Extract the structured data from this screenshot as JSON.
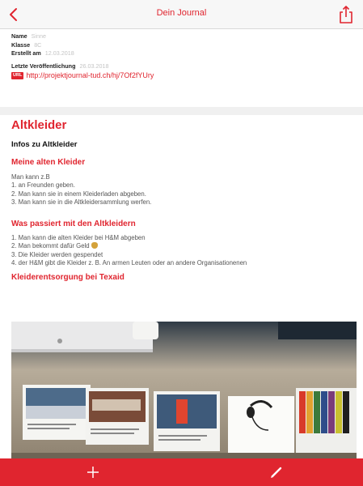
{
  "header": {
    "title": "Dein Journal"
  },
  "meta": {
    "name_label": "Name",
    "name_value": "Sinne",
    "class_label": "Klasse",
    "class_value": "8C",
    "created_label": "Erstellt am",
    "created_value": "12.03.2018",
    "published_label": "Letzte Veröffentlichung",
    "published_value": "26.03.2018",
    "url_badge": "URL",
    "url": "http://projektjournal-tud.ch/hj/7Of2fYUry"
  },
  "content": {
    "title": "Altkleider",
    "subtitle": "Infos zu Altkleider",
    "sections": [
      {
        "heading": "Meine alten Kleider",
        "lines": [
          "Man kann z.B",
          "1. an  Freunden geben.",
          "2. Man kann sie in einem Kleiderladen abgeben.",
          "3. Man kann sie in die Altkleidersammlung werfen."
        ]
      },
      {
        "heading": "Was passiert mit den Altkleidern",
        "lines": [
          "1. Man kann die alten Kleider bei H&M abgeben",
          "2. Man bekommt dafür Geld",
          "3. Die Kleider  werden gespendet",
          "4. der H&M  gibt die Kleider z. B. An armen Leuten oder an andere Organisationenen"
        ]
      },
      {
        "heading": "Kleiderentsorgung bei Texaid"
      }
    ]
  },
  "colors": {
    "accent": "#e0252f",
    "toolbar": "#e0252f",
    "muted": "#c4c4c4"
  },
  "icons": {
    "back": "chevron-left-icon",
    "share": "share-icon",
    "add": "plus-icon",
    "edit": "pencil-icon"
  }
}
